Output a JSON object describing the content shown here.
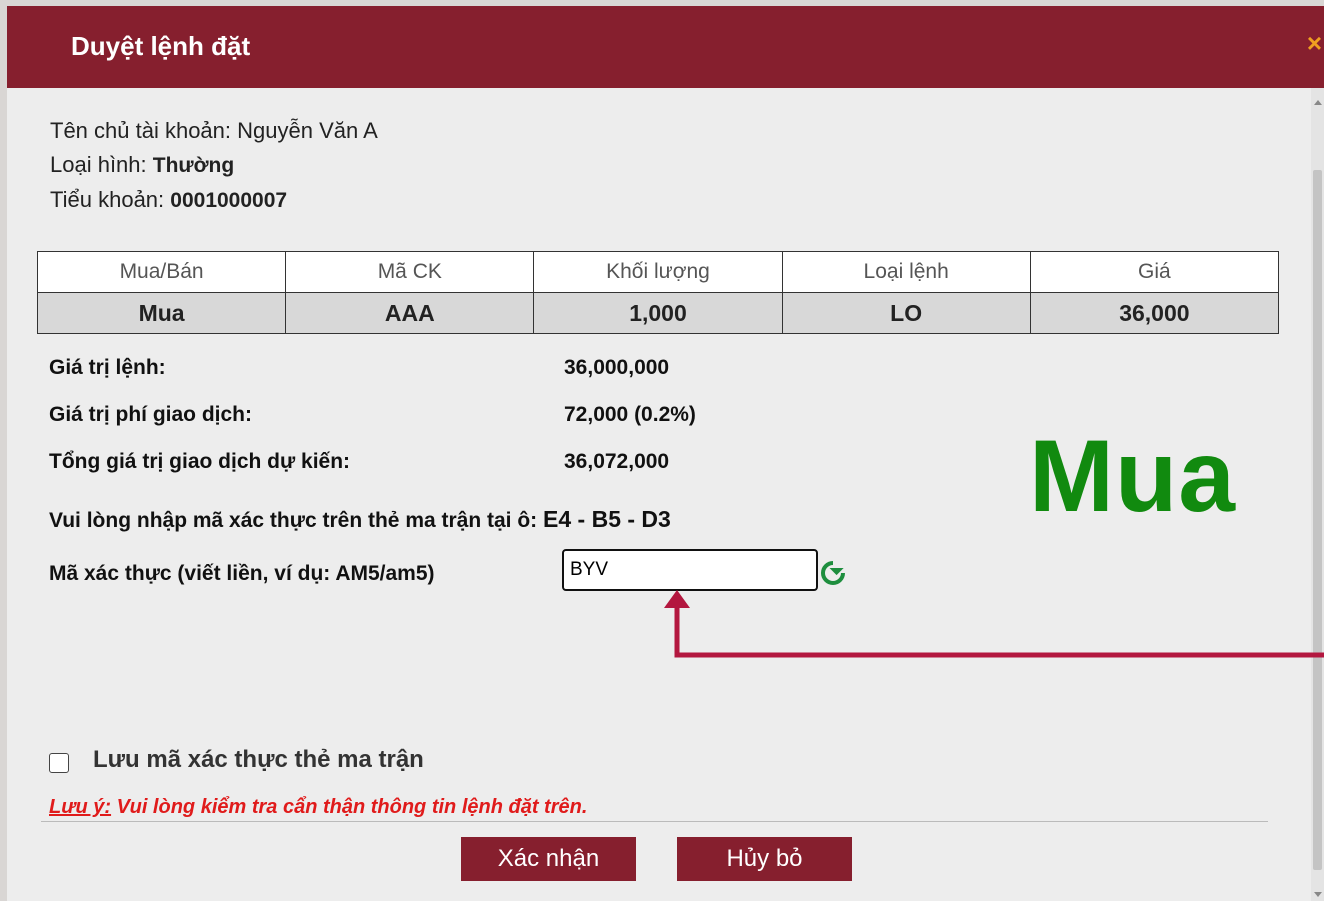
{
  "dialog": {
    "title": "Duyệt lệnh đặt",
    "close_glyph": "×"
  },
  "account": {
    "owner_label": "Tên chủ tài khoản:",
    "owner_value": "Nguyễn Văn A",
    "type_label": "Loại hình:",
    "type_value": "Thường",
    "sub_label": "Tiểu khoản:",
    "sub_value": "0001000007"
  },
  "order_table": {
    "headers": [
      "Mua/Bán",
      "Mã CK",
      "Khối lượng",
      "Loại lệnh",
      "Giá"
    ],
    "row": [
      "Mua",
      "AAA",
      "1,000",
      "LO",
      "36,000"
    ]
  },
  "summary": {
    "order_value_label": "Giá trị lệnh:",
    "order_value": "36,000,000",
    "fee_label": "Giá trị phí giao dịch:",
    "fee_value": "72,000 (0.2%)",
    "total_label": "Tổng giá trị giao dịch dự kiến:",
    "total_value": "36,072,000"
  },
  "side_banner": "Mua",
  "auth": {
    "prompt": "Vui lòng nhập mã xác thực trên thẻ ma trận tại ô:",
    "cells": "E4 - B5 - D3",
    "code_label": "Mã xác thực (viết liền, ví dụ: AM5/am5)",
    "code_value": "BYV",
    "refresh_icon": "refresh-icon",
    "refresh_color": "#1e8e3e"
  },
  "save_option": {
    "label": "Lưu mã xác thực thẻ ma trận",
    "checked": false
  },
  "note": {
    "prefix": "Lưu ý:",
    "text": " Vui lòng kiểm tra cẩn thận thông tin lệnh đặt trên."
  },
  "buttons": {
    "confirm": "Xác nhận",
    "cancel": "Hủy bỏ"
  },
  "colors": {
    "brand": "#861f2e",
    "buy_green": "#118a0f",
    "warning_red": "#e01b1b",
    "arrow": "#b3173f"
  }
}
